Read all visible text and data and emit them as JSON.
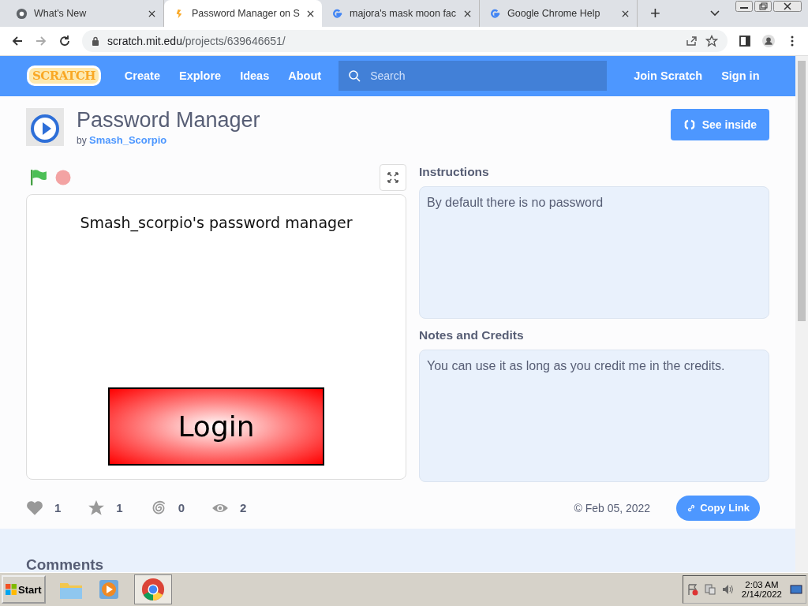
{
  "browser": {
    "tabs": [
      {
        "title": "What's New",
        "selected": false
      },
      {
        "title": "Password Manager on S",
        "selected": true
      },
      {
        "title": "majora's mask moon fac",
        "selected": false
      },
      {
        "title": "Google Chrome Help",
        "selected": false
      }
    ],
    "new_tab": "+",
    "address": {
      "host": "scratch.mit.edu",
      "path": "/projects/639646651/"
    }
  },
  "nav": {
    "logo": "SCRATCH",
    "links": [
      "Create",
      "Explore",
      "Ideas",
      "About"
    ],
    "search": {
      "placeholder": "Search"
    },
    "right": [
      "Join Scratch",
      "Sign in"
    ]
  },
  "project": {
    "title": "Password Manager",
    "by": "by",
    "author": "Smash_Scorpio",
    "see_inside": "See inside",
    "stage": {
      "heading": "Smash_scorpio's password manager",
      "button": "Login"
    },
    "instructions": {
      "title": "Instructions",
      "text": "By default there is no password"
    },
    "notes": {
      "title": "Notes and Credits",
      "text": "You can use it as long as you credit me in the credits."
    },
    "stats": [
      {
        "kind": "love",
        "count": "1"
      },
      {
        "kind": "favorite",
        "count": "1"
      },
      {
        "kind": "remix",
        "count": "0"
      },
      {
        "kind": "view",
        "count": "2"
      }
    ],
    "date": "© Feb 05, 2022",
    "copy_link": "Copy Link"
  },
  "comments": {
    "title": "Comments"
  },
  "taskbar": {
    "start": "Start",
    "time": "2:03 AM",
    "date": "2/14/2022"
  }
}
